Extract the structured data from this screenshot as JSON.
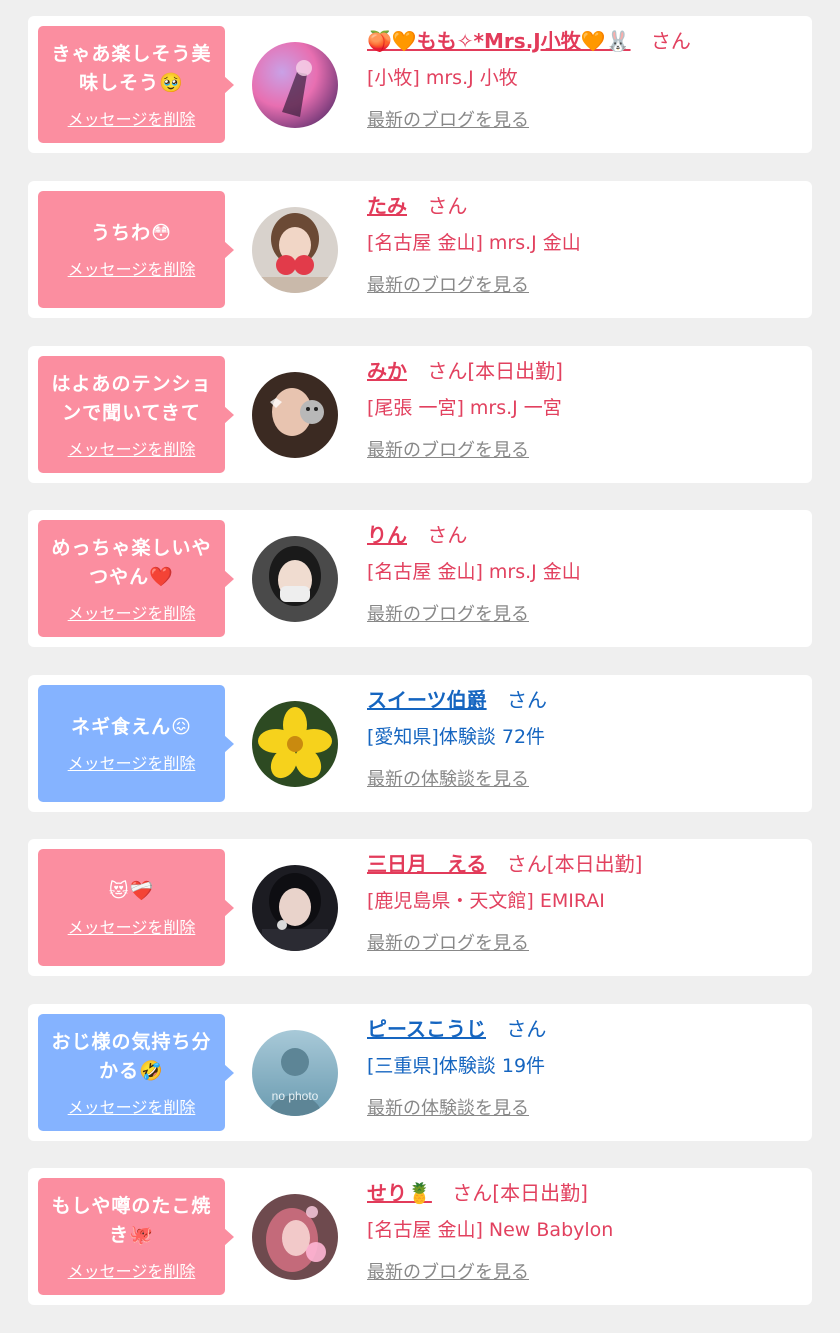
{
  "items": [
    {
      "message": "きゃあ楽しそう美味しそう🥹",
      "delete_label": "メッセージを削除",
      "bubble_color": "#fb8ea0",
      "name": "🍑🧡もも✧*Mrs.J小牧🧡🐰",
      "suffix": "さん",
      "store": "[小牧] mrs.J 小牧",
      "link": "最新のブログを見る",
      "avatar": "avatar-photo-pink",
      "text_color": "#e2415f"
    },
    {
      "message": "うちわ😳",
      "delete_label": "メッセージを削除",
      "bubble_color": "#fb8ea0",
      "name": "たみ",
      "suffix": "さん",
      "store": "[名古屋 金山] mrs.J 金山",
      "link": "最新のブログを見る",
      "avatar": "avatar-photo-strawberry",
      "text_color": "#e2415f"
    },
    {
      "message": "はよあのテンションで聞いてきて",
      "delete_label": "メッセージを削除",
      "bubble_color": "#fb8ea0",
      "name": "みか",
      "suffix": "さん[本日出勤]",
      "store": "[尾張 一宮] mrs.J 一宮",
      "link": "最新のブログを見る",
      "avatar": "avatar-photo-cat-sticker",
      "text_color": "#e2415f"
    },
    {
      "message": "めっちゃ楽しいやつやん❤️",
      "delete_label": "メッセージを削除",
      "bubble_color": "#fb8ea0",
      "name": "りん",
      "suffix": "さん",
      "store": "[名古屋 金山] mrs.J 金山",
      "link": "最新のブログを見る",
      "avatar": "avatar-photo-mask",
      "text_color": "#e2415f"
    },
    {
      "message": "ネギ食えん😖",
      "delete_label": "メッセージを削除",
      "bubble_color": "#85b3ff",
      "name": "スイーツ伯爵",
      "suffix": "さん",
      "store": "[愛知県]体験談 72件",
      "link": "最新の体験談を見る",
      "avatar": "avatar-photo-yellow-flower",
      "text_color": "#1565c0"
    },
    {
      "message": "😻❤️‍🩹",
      "delete_label": "メッセージを削除",
      "bubble_color": "#fb8ea0",
      "name": "三日月　える",
      "suffix": "さん[本日出勤]",
      "store": "[鹿児島県・天文館] EMIRAI",
      "link": "最新のブログを見る",
      "avatar": "avatar-photo-dark-hair",
      "text_color": "#e2415f"
    },
    {
      "message": "おじ様の気持ち分かる🤣",
      "delete_label": "メッセージを削除",
      "bubble_color": "#85b3ff",
      "name": "ピースこうじ",
      "suffix": "さん",
      "store": "[三重県]体験談 19件",
      "link": "最新の体験談を見る",
      "avatar": "avatar-no-photo",
      "avatar_text": "no photo",
      "text_color": "#1565c0"
    },
    {
      "message": "もしや噂のたこ焼き🐙",
      "delete_label": "メッセージを削除",
      "bubble_color": "#fb8ea0",
      "name": "せり🍍",
      "suffix": "さん[本日出勤]",
      "store": "[名古屋 金山] New Babylon",
      "link": "最新のブログを見る",
      "avatar": "avatar-photo-pink-hair",
      "text_color": "#e2415f"
    }
  ]
}
